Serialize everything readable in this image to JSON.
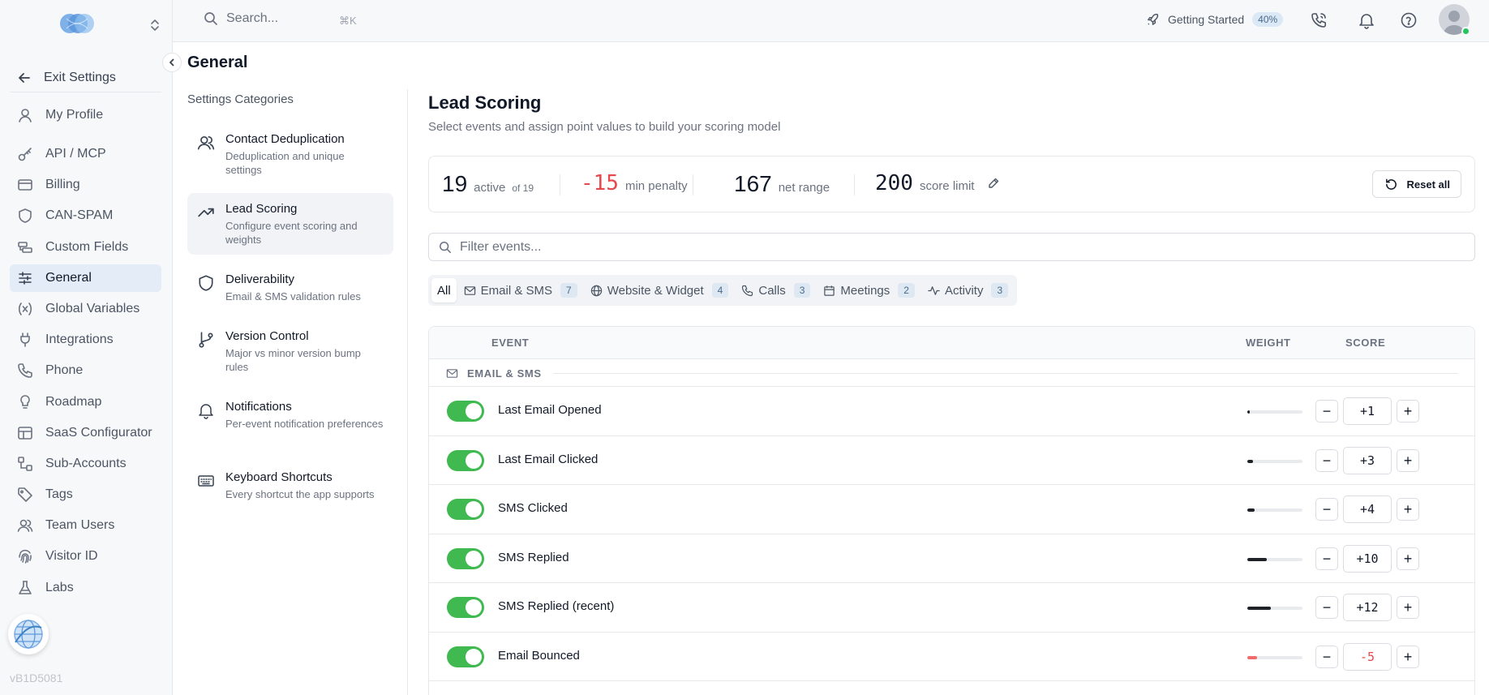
{
  "search": {
    "placeholder": "Search...",
    "shortcut": "⌘K"
  },
  "topbar": {
    "getting_started": "Getting Started",
    "progress": "40%"
  },
  "sidebar": {
    "exit": "Exit Settings",
    "items": [
      {
        "label": "My Profile",
        "icon": "user-icon"
      },
      {
        "label": "API / MCP",
        "icon": "key-icon"
      },
      {
        "label": "Billing",
        "icon": "credit-card-icon"
      },
      {
        "label": "CAN-SPAM",
        "icon": "shield-icon"
      },
      {
        "label": "Custom Fields",
        "icon": "fields-icon"
      },
      {
        "label": "General",
        "icon": "sliders-icon"
      },
      {
        "label": "Global Variables",
        "icon": "variable-icon"
      },
      {
        "label": "Integrations",
        "icon": "plug-icon"
      },
      {
        "label": "Phone",
        "icon": "phone-icon"
      },
      {
        "label": "Roadmap",
        "icon": "lightbulb-icon"
      },
      {
        "label": "SaaS Configurator",
        "icon": "layout-icon"
      },
      {
        "label": "Sub-Accounts",
        "icon": "sub-accounts-icon"
      },
      {
        "label": "Tags",
        "icon": "tag-icon"
      },
      {
        "label": "Team Users",
        "icon": "users-icon"
      },
      {
        "label": "Visitor ID",
        "icon": "fingerprint-icon"
      },
      {
        "label": "Labs",
        "icon": "flask-icon"
      }
    ],
    "version": "vB1D5081"
  },
  "page": {
    "title": "General"
  },
  "categories": {
    "title": "Settings Categories",
    "items": [
      {
        "title": "Contact Deduplication",
        "desc": "Deduplication and unique settings"
      },
      {
        "title": "Lead Scoring",
        "desc": "Configure event scoring and weights"
      },
      {
        "title": "Deliverability",
        "desc": "Email & SMS validation rules"
      },
      {
        "title": "Version Control",
        "desc": "Major vs minor version bump rules"
      },
      {
        "title": "Notifications",
        "desc": "Per-event notification preferences"
      },
      {
        "title": "Keyboard Shortcuts",
        "desc": "Every shortcut the app supports"
      }
    ]
  },
  "main": {
    "title": "Lead Scoring",
    "subtitle": "Select events and assign point values to build your scoring model"
  },
  "stats": {
    "active": "19",
    "active_label": "active",
    "active_of": "of 19",
    "penalty": "-15",
    "penalty_label": "min penalty",
    "range": "167",
    "range_label": "net range",
    "limit": "200",
    "limit_label": "score limit",
    "reset": "Reset all"
  },
  "filter": {
    "placeholder": "Filter events..."
  },
  "tabs": [
    {
      "label": "All",
      "count": ""
    },
    {
      "label": "Email & SMS",
      "count": "7"
    },
    {
      "label": "Website & Widget",
      "count": "4"
    },
    {
      "label": "Calls",
      "count": "3"
    },
    {
      "label": "Meetings",
      "count": "2"
    },
    {
      "label": "Activity",
      "count": "3"
    }
  ],
  "table": {
    "headers": {
      "event": "EVENT",
      "weight": "WEIGHT",
      "score": "SCORE"
    },
    "group": "EMAIL & SMS",
    "rows": [
      {
        "event": "Last Email Opened",
        "score": "+1",
        "weight": 0.04
      },
      {
        "event": "Last Email Clicked",
        "score": "+3",
        "weight": 0.1
      },
      {
        "event": "SMS Clicked",
        "score": "+4",
        "weight": 0.13
      },
      {
        "event": "SMS Replied",
        "score": "+10",
        "weight": 0.35
      },
      {
        "event": "SMS Replied (recent)",
        "score": "+12",
        "weight": 0.42
      },
      {
        "event": "Email Bounced",
        "score": "-5",
        "weight": 0.17,
        "negative": true
      }
    ]
  },
  "colors": {
    "accent": "#3fb950",
    "negative": "#e5484d",
    "active_nav": "#e3ecf7"
  }
}
